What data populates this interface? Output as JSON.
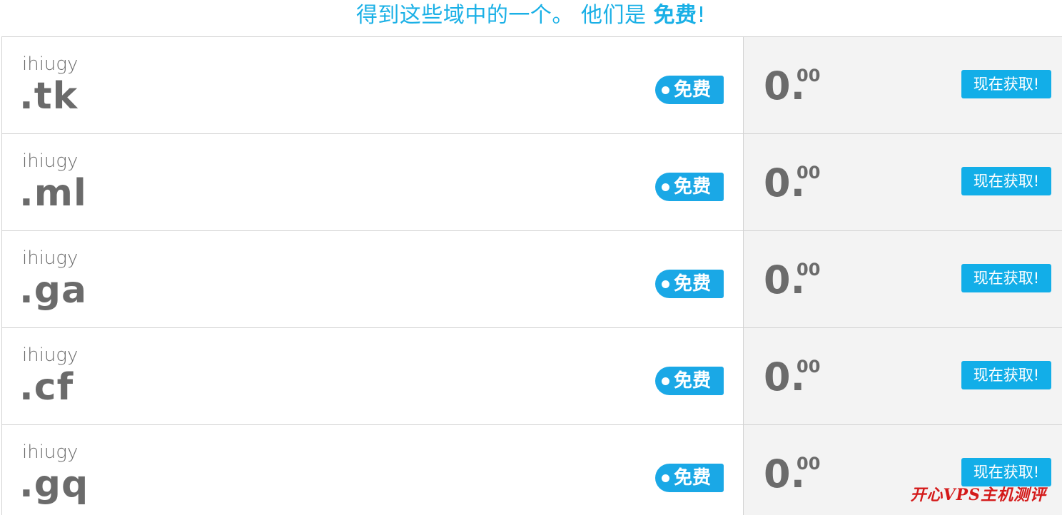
{
  "header": {
    "text_main": "得到这些域中的一个。 他们是 ",
    "text_free": "免费",
    "text_end": "!"
  },
  "rows": [
    {
      "sld": "ihiugy",
      "tld": ".tk",
      "badge": "免费",
      "price_int": "0",
      "price_sep": ".",
      "price_cents": "00",
      "button": "现在获取!"
    },
    {
      "sld": "ihiugy",
      "tld": ".ml",
      "badge": "免费",
      "price_int": "0",
      "price_sep": ".",
      "price_cents": "00",
      "button": "现在获取!"
    },
    {
      "sld": "ihiugy",
      "tld": ".ga",
      "badge": "免费",
      "price_int": "0",
      "price_sep": ".",
      "price_cents": "00",
      "button": "现在获取!"
    },
    {
      "sld": "ihiugy",
      "tld": ".cf",
      "badge": "免费",
      "price_int": "0",
      "price_sep": ".",
      "price_cents": "00",
      "button": "现在获取!"
    },
    {
      "sld": "ihiugy",
      "tld": ".gq",
      "badge": "免费",
      "price_int": "0",
      "price_sep": ".",
      "price_cents": "00",
      "button": "现在获取!"
    }
  ],
  "watermark": "开心VPS主机测评",
  "colors": {
    "accent": "#1ab0e6",
    "button": "#12aee8",
    "text_gray": "#6b6b6b",
    "price_panel_bg": "#f3f3f3",
    "watermark": "#d41a1a"
  },
  "icons": {
    "badge_dot": "dot-icon"
  }
}
